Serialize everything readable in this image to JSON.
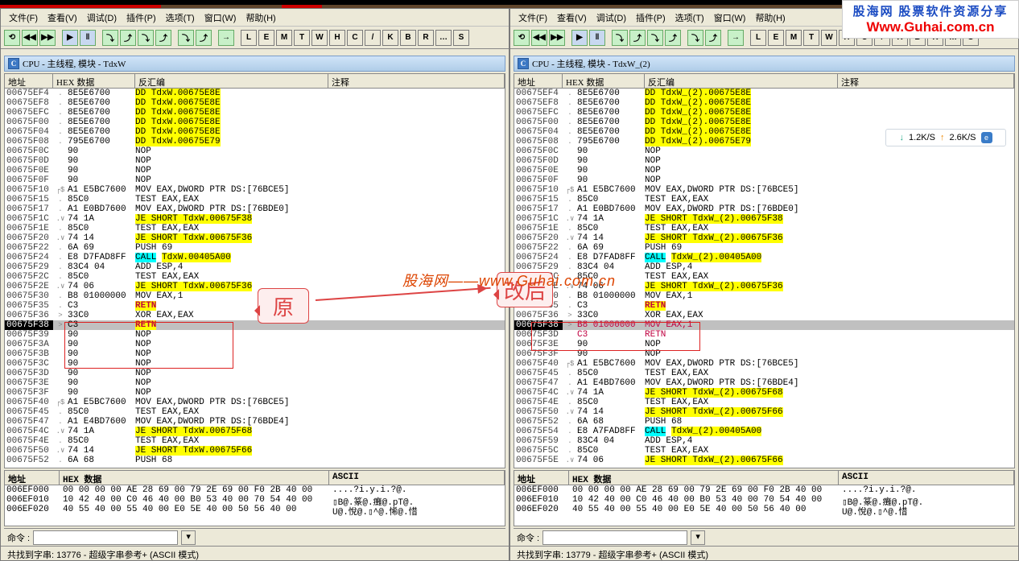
{
  "menus": [
    "文件(F)",
    "查看(V)",
    "调试(D)",
    "插件(P)",
    "选项(T)",
    "窗口(W)",
    "帮助(H)"
  ],
  "tbtns": [
    "⟲",
    "◀◀",
    "▶▶",
    "",
    "▶",
    "‖",
    "",
    "⤵",
    "⤴",
    "⤵",
    "⤴",
    "",
    "⤵",
    "⤴",
    "",
    "→",
    "",
    "L",
    "E",
    "M",
    "T",
    "W",
    "H",
    "C",
    "/",
    "K",
    "B",
    "R",
    "…",
    "S",
    ""
  ],
  "left": {
    "title": "CPU - 主线程, 模块 - TdxW",
    "headers": {
      "addr": "地址",
      "hex": "HEX 数据",
      "asm": "反汇编",
      "cmt": "注释"
    },
    "rows": [
      {
        "a": "00675EF4",
        "m": ".",
        "h": "8E5E6700",
        "d": "DD TdxW.00675E8E",
        "cls": "hy"
      },
      {
        "a": "00675EF8",
        "m": ".",
        "h": "8E5E6700",
        "d": "DD TdxW.00675E8E",
        "cls": "hy"
      },
      {
        "a": "00675EFC",
        "m": ".",
        "h": "8E5E6700",
        "d": "DD TdxW.00675E8E",
        "cls": "hy"
      },
      {
        "a": "00675F00",
        "m": ".",
        "h": "8E5E6700",
        "d": "DD TdxW.00675E8E",
        "cls": "hy"
      },
      {
        "a": "00675F04",
        "m": ".",
        "h": "8E5E6700",
        "d": "DD TdxW.00675E8E",
        "cls": "hy"
      },
      {
        "a": "00675F08",
        "m": ".",
        "h": "795E6700",
        "d": "DD TdxW.00675E79",
        "cls": "hy"
      },
      {
        "a": "00675F0C",
        "m": "",
        "h": "90",
        "d": "NOP",
        "cls": ""
      },
      {
        "a": "00675F0D",
        "m": "",
        "h": "90",
        "d": "NOP",
        "cls": ""
      },
      {
        "a": "00675F0E",
        "m": "",
        "h": "90",
        "d": "NOP",
        "cls": ""
      },
      {
        "a": "00675F0F",
        "m": "",
        "h": "90",
        "d": "NOP",
        "cls": ""
      },
      {
        "a": "00675F10",
        "m": "┌$",
        "h": "A1 E5BC7600",
        "d": "MOV EAX,DWORD PTR DS:[76BCE5]",
        "cls": ""
      },
      {
        "a": "00675F15",
        "m": ".",
        "h": "85C0",
        "d": "TEST EAX,EAX",
        "cls": ""
      },
      {
        "a": "00675F17",
        "m": ".",
        "h": "A1 E0BD7600",
        "d": "MOV EAX,DWORD PTR DS:[76BDE0]",
        "cls": ""
      },
      {
        "a": "00675F1C",
        "m": ".∨",
        "h": "74 1A",
        "d": "JE SHORT TdxW.00675F38",
        "cls": "hy"
      },
      {
        "a": "00675F1E",
        "m": ".",
        "h": "85C0",
        "d": "TEST EAX,EAX",
        "cls": ""
      },
      {
        "a": "00675F20",
        "m": ".∨",
        "h": "74 14",
        "d": "JE SHORT TdxW.00675F36",
        "cls": "hy"
      },
      {
        "a": "00675F22",
        "m": ".",
        "h": "6A 69",
        "d": "PUSH 69",
        "cls": ""
      },
      {
        "a": "00675F24",
        "m": ".",
        "h": "E8 D7FAD8FF",
        "d": "CALL TdxW.00405A00",
        "cls": "hc"
      },
      {
        "a": "00675F29",
        "m": ".",
        "h": "83C4 04",
        "d": "ADD ESP,4",
        "cls": ""
      },
      {
        "a": "00675F2C",
        "m": ".",
        "h": "85C0",
        "d": "TEST EAX,EAX",
        "cls": ""
      },
      {
        "a": "00675F2E",
        "m": ".∨",
        "h": "74 06",
        "d": "JE SHORT TdxW.00675F36",
        "cls": "hy"
      },
      {
        "a": "00675F30",
        "m": ".",
        "h": "B8 01000000",
        "d": "MOV EAX,1",
        "cls": ""
      },
      {
        "a": "00675F35",
        "m": ".",
        "h": "C3",
        "d": "RETN",
        "cls": "retn"
      },
      {
        "a": "00675F36",
        "m": ">",
        "h": "33C0",
        "d": "XOR EAX,EAX",
        "cls": ""
      },
      {
        "a": "00675F38",
        "m": ">",
        "h": "C3",
        "d": "RETN",
        "cls": "retn",
        "sel": true
      },
      {
        "a": "00675F39",
        "m": "",
        "h": "90",
        "d": "NOP",
        "cls": ""
      },
      {
        "a": "00675F3A",
        "m": "",
        "h": "90",
        "d": "NOP",
        "cls": ""
      },
      {
        "a": "00675F3B",
        "m": "",
        "h": "90",
        "d": "NOP",
        "cls": ""
      },
      {
        "a": "00675F3C",
        "m": "",
        "h": "90",
        "d": "NOP",
        "cls": ""
      },
      {
        "a": "00675F3D",
        "m": "",
        "h": "90",
        "d": "NOP",
        "cls": ""
      },
      {
        "a": "00675F3E",
        "m": "",
        "h": "90",
        "d": "NOP",
        "cls": ""
      },
      {
        "a": "00675F3F",
        "m": "",
        "h": "90",
        "d": "NOP",
        "cls": ""
      },
      {
        "a": "00675F40",
        "m": "┌$",
        "h": "A1 E5BC7600",
        "d": "MOV EAX,DWORD PTR DS:[76BCE5]",
        "cls": ""
      },
      {
        "a": "00675F45",
        "m": ".",
        "h": "85C0",
        "d": "TEST EAX,EAX",
        "cls": ""
      },
      {
        "a": "00675F47",
        "m": ".",
        "h": "A1 E4BD7600",
        "d": "MOV EAX,DWORD PTR DS:[76BDE4]",
        "cls": ""
      },
      {
        "a": "00675F4C",
        "m": ".∨",
        "h": "74 1A",
        "d": "JE SHORT TdxW.00675F68",
        "cls": "hy"
      },
      {
        "a": "00675F4E",
        "m": ".",
        "h": "85C0",
        "d": "TEST EAX,EAX",
        "cls": ""
      },
      {
        "a": "00675F50",
        "m": ".∨",
        "h": "74 14",
        "d": "JE SHORT TdxW.00675F66",
        "cls": "hy"
      },
      {
        "a": "00675F52",
        "m": ".",
        "h": "6A 68",
        "d": "PUSH 68",
        "cls": ""
      }
    ],
    "hex": {
      "headers": {
        "addr": "地址",
        "data": "HEX 数据",
        "ascii": "ASCII"
      },
      "rows": [
        {
          "a": "006EF000",
          "b": "00 00 00 00 AE 28 69 00 79 2E 69 00 F0 2B 40 00",
          "c": "....?i.y.i.?@."
        },
        {
          "a": "006EF010",
          "b": "10 42 40 00 C0 46 40 00 B0 53 40 00 70 54 40 00",
          "c": "▯B@.篆@.癱@.pT@."
        },
        {
          "a": "006EF020",
          "b": "40 55 40 00 55 40 00 E0 5E 40 00 50 56 40 00",
          "c": "U@.悅@.▯^@.悕@.惜"
        }
      ]
    },
    "cmd_label": "命令 :",
    "status": "共找到字串: 13776  -  超级字串参考+  (ASCII 模式)"
  },
  "right": {
    "title": "CPU - 主线程, 模块 - TdxW_(2)",
    "headers": {
      "addr": "地址",
      "hex": "HEX 数据",
      "asm": "反汇编",
      "cmt": "注释"
    },
    "rows": [
      {
        "a": "00675EF4",
        "m": ".",
        "h": "8E5E6700",
        "d": "DD TdxW_(2).00675E8E",
        "cls": "hy"
      },
      {
        "a": "00675EF8",
        "m": ".",
        "h": "8E5E6700",
        "d": "DD TdxW_(2).00675E8E",
        "cls": "hy"
      },
      {
        "a": "00675EFC",
        "m": ".",
        "h": "8E5E6700",
        "d": "DD TdxW_(2).00675E8E",
        "cls": "hy"
      },
      {
        "a": "00675F00",
        "m": ".",
        "h": "8E5E6700",
        "d": "DD TdxW_(2).00675E8E",
        "cls": "hy"
      },
      {
        "a": "00675F04",
        "m": ".",
        "h": "8E5E6700",
        "d": "DD TdxW_(2).00675E8E",
        "cls": "hy"
      },
      {
        "a": "00675F08",
        "m": ".",
        "h": "795E6700",
        "d": "DD TdxW_(2).00675E79",
        "cls": "hy"
      },
      {
        "a": "00675F0C",
        "m": "",
        "h": "90",
        "d": "NOP",
        "cls": ""
      },
      {
        "a": "00675F0D",
        "m": "",
        "h": "90",
        "d": "NOP",
        "cls": ""
      },
      {
        "a": "00675F0E",
        "m": "",
        "h": "90",
        "d": "NOP",
        "cls": ""
      },
      {
        "a": "00675F0F",
        "m": "",
        "h": "90",
        "d": "NOP",
        "cls": ""
      },
      {
        "a": "00675F10",
        "m": "┌$",
        "h": "A1 E5BC7600",
        "d": "MOV EAX,DWORD PTR DS:[76BCE5]",
        "cls": ""
      },
      {
        "a": "00675F15",
        "m": ".",
        "h": "85C0",
        "d": "TEST EAX,EAX",
        "cls": ""
      },
      {
        "a": "00675F17",
        "m": ".",
        "h": "A1 E0BD7600",
        "d": "MOV EAX,DWORD PTR DS:[76BDE0]",
        "cls": ""
      },
      {
        "a": "00675F1C",
        "m": ".∨",
        "h": "74 1A",
        "d": "JE SHORT TdxW_(2).00675F38",
        "cls": "hy"
      },
      {
        "a": "00675F1E",
        "m": ".",
        "h": "85C0",
        "d": "TEST EAX,EAX",
        "cls": ""
      },
      {
        "a": "00675F20",
        "m": ".∨",
        "h": "74 14",
        "d": "JE SHORT TdxW_(2).00675F36",
        "cls": "hy"
      },
      {
        "a": "00675F22",
        "m": ".",
        "h": "6A 69",
        "d": "PUSH 69",
        "cls": ""
      },
      {
        "a": "00675F24",
        "m": ".",
        "h": "E8 D7FAD8FF",
        "d": "CALL TdxW_(2).00405A00",
        "cls": "hc"
      },
      {
        "a": "00675F29",
        "m": ".",
        "h": "83C4 04",
        "d": "ADD ESP,4",
        "cls": ""
      },
      {
        "a": "00675F2C",
        "m": ".",
        "h": "85C0",
        "d": "TEST EAX,EAX",
        "cls": ""
      },
      {
        "a": "00675F2E",
        "m": ".∨",
        "h": "74 06",
        "d": "JE SHORT TdxW_(2).00675F36",
        "cls": "hy"
      },
      {
        "a": "00675F30",
        "m": ".",
        "h": "B8 01000000",
        "d": "MOV EAX,1",
        "cls": ""
      },
      {
        "a": "00675F35",
        "m": ".",
        "h": "C3",
        "d": "RETN",
        "cls": "retn"
      },
      {
        "a": "00675F36",
        "m": ">",
        "h": "33C0",
        "d": "XOR EAX,EAX",
        "cls": ""
      },
      {
        "a": "00675F38",
        "m": ">",
        "h": "B8 01000000",
        "d": "MOV EAX,1",
        "cls": "red",
        "sel": true
      },
      {
        "a": "00675F3D",
        "m": "",
        "h": "C3",
        "d": "RETN",
        "cls": "red"
      },
      {
        "a": "00675F3E",
        "m": "",
        "h": "90",
        "d": "NOP",
        "cls": ""
      },
      {
        "a": "00675F3F",
        "m": "",
        "h": "90",
        "d": "NOP",
        "cls": ""
      },
      {
        "a": "00675F40",
        "m": "┌$",
        "h": "A1 E5BC7600",
        "d": "MOV EAX,DWORD PTR DS:[76BCE5]",
        "cls": ""
      },
      {
        "a": "00675F45",
        "m": ".",
        "h": "85C0",
        "d": "TEST EAX,EAX",
        "cls": ""
      },
      {
        "a": "00675F47",
        "m": ".",
        "h": "A1 E4BD7600",
        "d": "MOV EAX,DWORD PTR DS:[76BDE4]",
        "cls": ""
      },
      {
        "a": "00675F4C",
        "m": ".∨",
        "h": "74 1A",
        "d": "JE SHORT TdxW_(2).00675F68",
        "cls": "hy"
      },
      {
        "a": "00675F4E",
        "m": ".",
        "h": "85C0",
        "d": "TEST EAX,EAX",
        "cls": ""
      },
      {
        "a": "00675F50",
        "m": ".∨",
        "h": "74 14",
        "d": "JE SHORT TdxW_(2).00675F66",
        "cls": "hy"
      },
      {
        "a": "00675F52",
        "m": ".",
        "h": "6A 68",
        "d": "PUSH 68",
        "cls": ""
      },
      {
        "a": "00675F54",
        "m": ".",
        "h": "E8 A7FAD8FF",
        "d": "CALL TdxW_(2).00405A00",
        "cls": "hc"
      },
      {
        "a": "00675F59",
        "m": ".",
        "h": "83C4 04",
        "d": "ADD ESP,4",
        "cls": ""
      },
      {
        "a": "00675F5C",
        "m": ".",
        "h": "85C0",
        "d": "TEST EAX,EAX",
        "cls": ""
      },
      {
        "a": "00675F5E",
        "m": ".∨",
        "h": "74 06",
        "d": "JE SHORT TdxW_(2).00675F66",
        "cls": "hy"
      }
    ],
    "hex": {
      "headers": {
        "addr": "地址",
        "data": "HEX 数据",
        "ascii": "ASCII"
      },
      "rows": [
        {
          "a": "006EF000",
          "b": "00 00 00 00 AE 28 69 00 79 2E 69 00 F0 2B 40 00",
          "c": "....?i.y.i.?@."
        },
        {
          "a": "006EF010",
          "b": "10 42 40 00 C0 46 40 00 B0 53 40 00 70 54 40 00",
          "c": "▯B@.篆@.癱@.pT@."
        },
        {
          "a": "006EF020",
          "b": "40 55 40 00 55 40 00 E0 5E 40 00 50 56 40 00",
          "c": "U@.悅@.▯^@.惜"
        }
      ]
    },
    "cmd_label": "命令 :",
    "status": "共找到字串: 13779  -  超级字串参考+  (ASCII 模式)"
  },
  "watermark": "股海网——www.Guhai.com.cn",
  "logo": {
    "l1": "股海网 股票软件资源分享",
    "l2": "Www.Guhai.com.cn"
  },
  "speed": {
    "down": "1.2K/S",
    "up": "2.6K/S"
  },
  "callout1": "原",
  "callout2": "改后"
}
